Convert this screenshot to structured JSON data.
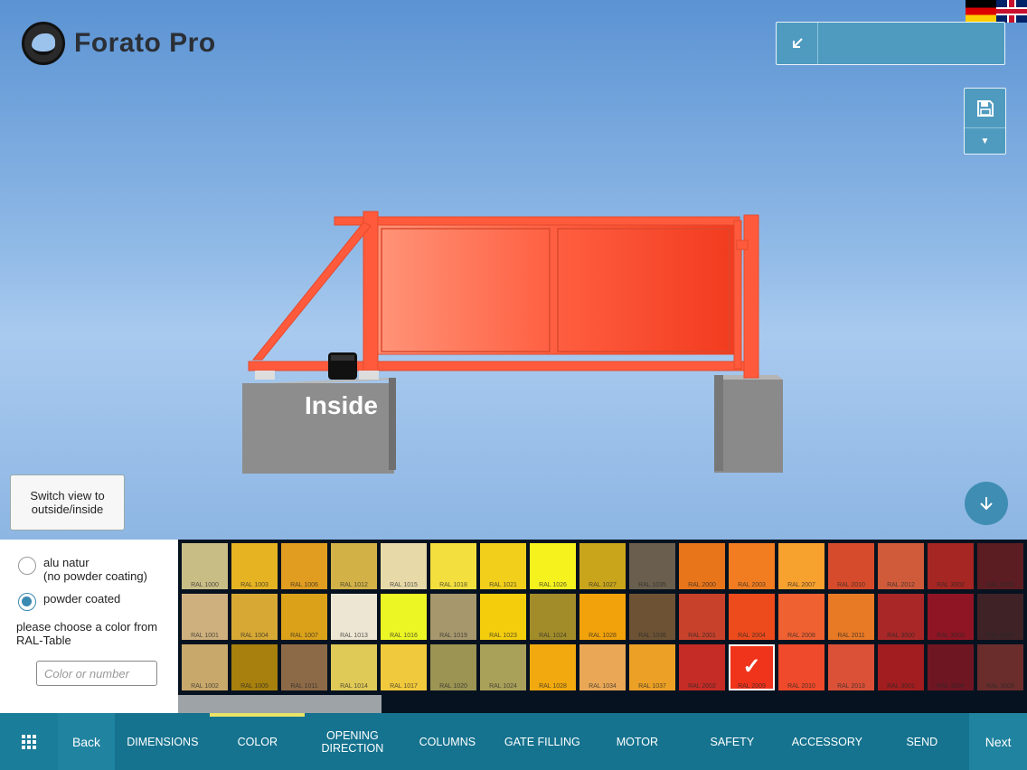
{
  "app": {
    "title": "Forato Pro"
  },
  "language": {
    "de_icon": "flag-de-icon",
    "en_icon": "flag-en-icon"
  },
  "scene": {
    "side_label": "Inside",
    "gate_color": "#ff5a3c"
  },
  "view_toggle": {
    "label": "Switch view to outside/inside"
  },
  "coating": {
    "options": [
      {
        "label_line1": "alu natur",
        "label_line2": "(no powder coating)",
        "selected": false
      },
      {
        "label_line1": "powder coated",
        "label_line2": "",
        "selected": true
      }
    ],
    "hint": "please choose a color from RAL-Table",
    "search_placeholder": "Color or number"
  },
  "palette": {
    "swatches": [
      {
        "code": "RAL 1000",
        "color": "#c9bd86"
      },
      {
        "code": "RAL 1003",
        "color": "#e6b422"
      },
      {
        "code": "RAL 1006",
        "color": "#e19d1f"
      },
      {
        "code": "RAL 1012",
        "color": "#d2b247"
      },
      {
        "code": "RAL 1015",
        "color": "#e7d9a8"
      },
      {
        "code": "RAL 1018",
        "color": "#f3e03f"
      },
      {
        "code": "RAL 1021",
        "color": "#f2cf1b"
      },
      {
        "code": "RAL 1026",
        "color": "#f6f21e"
      },
      {
        "code": "RAL 1027",
        "color": "#c9a51c"
      },
      {
        "code": "RAL 1035",
        "color": "#6a5f4e"
      },
      {
        "code": "RAL 2000",
        "color": "#e8751a"
      },
      {
        "code": "RAL 2003",
        "color": "#f27d20"
      },
      {
        "code": "RAL 2007",
        "color": "#f7a12e"
      },
      {
        "code": "RAL 2010",
        "color": "#d64b2b"
      },
      {
        "code": "RAL 2012",
        "color": "#cf5b3b"
      },
      {
        "code": "RAL 3002",
        "color": "#a52622"
      },
      {
        "code": "RAL 3005",
        "color": "#5b1d22"
      },
      {
        "code": "RAL 1001",
        "color": "#cdb07d"
      },
      {
        "code": "RAL 1004",
        "color": "#d7a934"
      },
      {
        "code": "RAL 1007",
        "color": "#dba119"
      },
      {
        "code": "RAL 1013",
        "color": "#ece6d3"
      },
      {
        "code": "RAL 1016",
        "color": "#ecf624"
      },
      {
        "code": "RAL 1019",
        "color": "#a6976d"
      },
      {
        "code": "RAL 1023",
        "color": "#f4cd0d"
      },
      {
        "code": "RAL 1024",
        "color": "#a28c2a"
      },
      {
        "code": "RAL 1028",
        "color": "#f2a20a"
      },
      {
        "code": "RAL 1036",
        "color": "#6d5334"
      },
      {
        "code": "RAL 2001",
        "color": "#c8412b"
      },
      {
        "code": "RAL 2004",
        "color": "#ed4b1c"
      },
      {
        "code": "RAL 2008",
        "color": "#f06131"
      },
      {
        "code": "RAL 2011",
        "color": "#e97a25"
      },
      {
        "code": "RAL 3000",
        "color": "#a92727"
      },
      {
        "code": "RAL 3003",
        "color": "#8f1524"
      },
      {
        "code": "RAL 3007",
        "color": "#3e2226"
      },
      {
        "code": "RAL 1002",
        "color": "#c9a86b"
      },
      {
        "code": "RAL 1005",
        "color": "#a7800d"
      },
      {
        "code": "RAL 1011",
        "color": "#8d6a47"
      },
      {
        "code": "RAL 1014",
        "color": "#dfc957"
      },
      {
        "code": "RAL 1017",
        "color": "#f1c93c"
      },
      {
        "code": "RAL 1020",
        "color": "#9b9453"
      },
      {
        "code": "RAL 1024",
        "color": "#a9a05a"
      },
      {
        "code": "RAL 1028",
        "color": "#f1a90f"
      },
      {
        "code": "RAL 1034",
        "color": "#eaa857"
      },
      {
        "code": "RAL 1037",
        "color": "#eca126"
      },
      {
        "code": "RAL 2002",
        "color": "#c52c26"
      },
      {
        "code": "RAL 2009",
        "color": "#f0331b",
        "selected": true
      },
      {
        "code": "RAL 2010",
        "color": "#ee4a2b"
      },
      {
        "code": "RAL 2013",
        "color": "#db5138"
      },
      {
        "code": "RAL 3001",
        "color": "#a11d1f"
      },
      {
        "code": "RAL 3004",
        "color": "#6f1623"
      },
      {
        "code": "RAL 3009",
        "color": "#6a2d2c"
      }
    ],
    "selected_icon": "checkmark-icon",
    "scroll_position": 0.24
  },
  "nav": {
    "menu_icon": "grid-menu-icon",
    "back": "Back",
    "next": "Next",
    "steps": [
      {
        "label": "DIMENSIONS",
        "active": false
      },
      {
        "label": "COLOR",
        "active": true
      },
      {
        "label": "OPENING DIRECTION",
        "active": false
      },
      {
        "label": "COLUMNS",
        "active": false
      },
      {
        "label": "GATE FILLING",
        "active": false
      },
      {
        "label": "MOTOR",
        "active": false
      },
      {
        "label": "SAFETY",
        "active": false
      },
      {
        "label": "ACCESSORY",
        "active": false
      },
      {
        "label": "SEND",
        "active": false
      }
    ]
  },
  "accent": "#15738f"
}
